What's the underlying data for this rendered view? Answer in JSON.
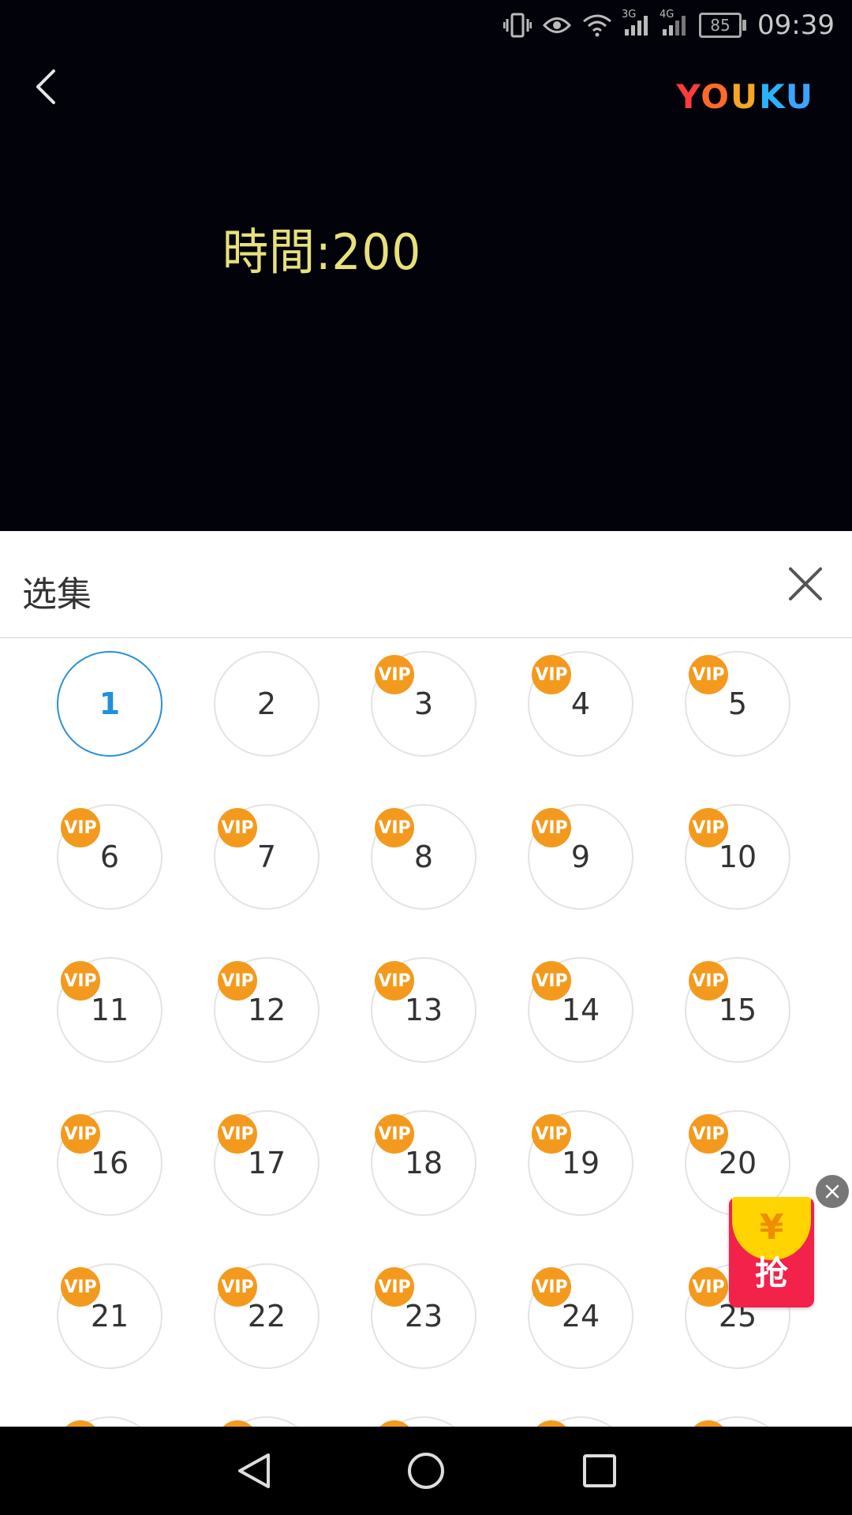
{
  "status_bar": {
    "battery": "85",
    "time": "09:39",
    "network_labels": [
      "3G",
      "4G"
    ]
  },
  "player": {
    "brand": {
      "letters": [
        "Y",
        "O",
        "U",
        "K",
        "U"
      ]
    },
    "overlay_text": "時間:200"
  },
  "episode_panel": {
    "title": "选集",
    "selected_episode": "1",
    "vip_badge_label": "VIP",
    "episodes": [
      {
        "number": "1",
        "vip": false
      },
      {
        "number": "2",
        "vip": false
      },
      {
        "number": "3",
        "vip": true
      },
      {
        "number": "4",
        "vip": true
      },
      {
        "number": "5",
        "vip": true
      },
      {
        "number": "6",
        "vip": true
      },
      {
        "number": "7",
        "vip": true
      },
      {
        "number": "8",
        "vip": true
      },
      {
        "number": "9",
        "vip": true
      },
      {
        "number": "10",
        "vip": true
      },
      {
        "number": "11",
        "vip": true
      },
      {
        "number": "12",
        "vip": true
      },
      {
        "number": "13",
        "vip": true
      },
      {
        "number": "14",
        "vip": true
      },
      {
        "number": "15",
        "vip": true
      },
      {
        "number": "16",
        "vip": true
      },
      {
        "number": "17",
        "vip": true
      },
      {
        "number": "18",
        "vip": true
      },
      {
        "number": "19",
        "vip": true
      },
      {
        "number": "20",
        "vip": true
      },
      {
        "number": "21",
        "vip": true
      },
      {
        "number": "22",
        "vip": true
      },
      {
        "number": "23",
        "vip": true
      },
      {
        "number": "24",
        "vip": true
      },
      {
        "number": "25",
        "vip": true
      }
    ]
  },
  "floating_ad": {
    "coin_symbol": "¥",
    "label": "抢"
  },
  "icons": {
    "back": "back-arrow-icon",
    "close": "close-icon",
    "nav": [
      "nav-back-icon",
      "nav-home-icon",
      "nav-recents-icon"
    ]
  },
  "colors": {
    "selected_accent": "#1e90dc",
    "vip_badge": "#f39a1e",
    "ad_red": "#f2224a",
    "ad_coin": "#ffd400"
  }
}
